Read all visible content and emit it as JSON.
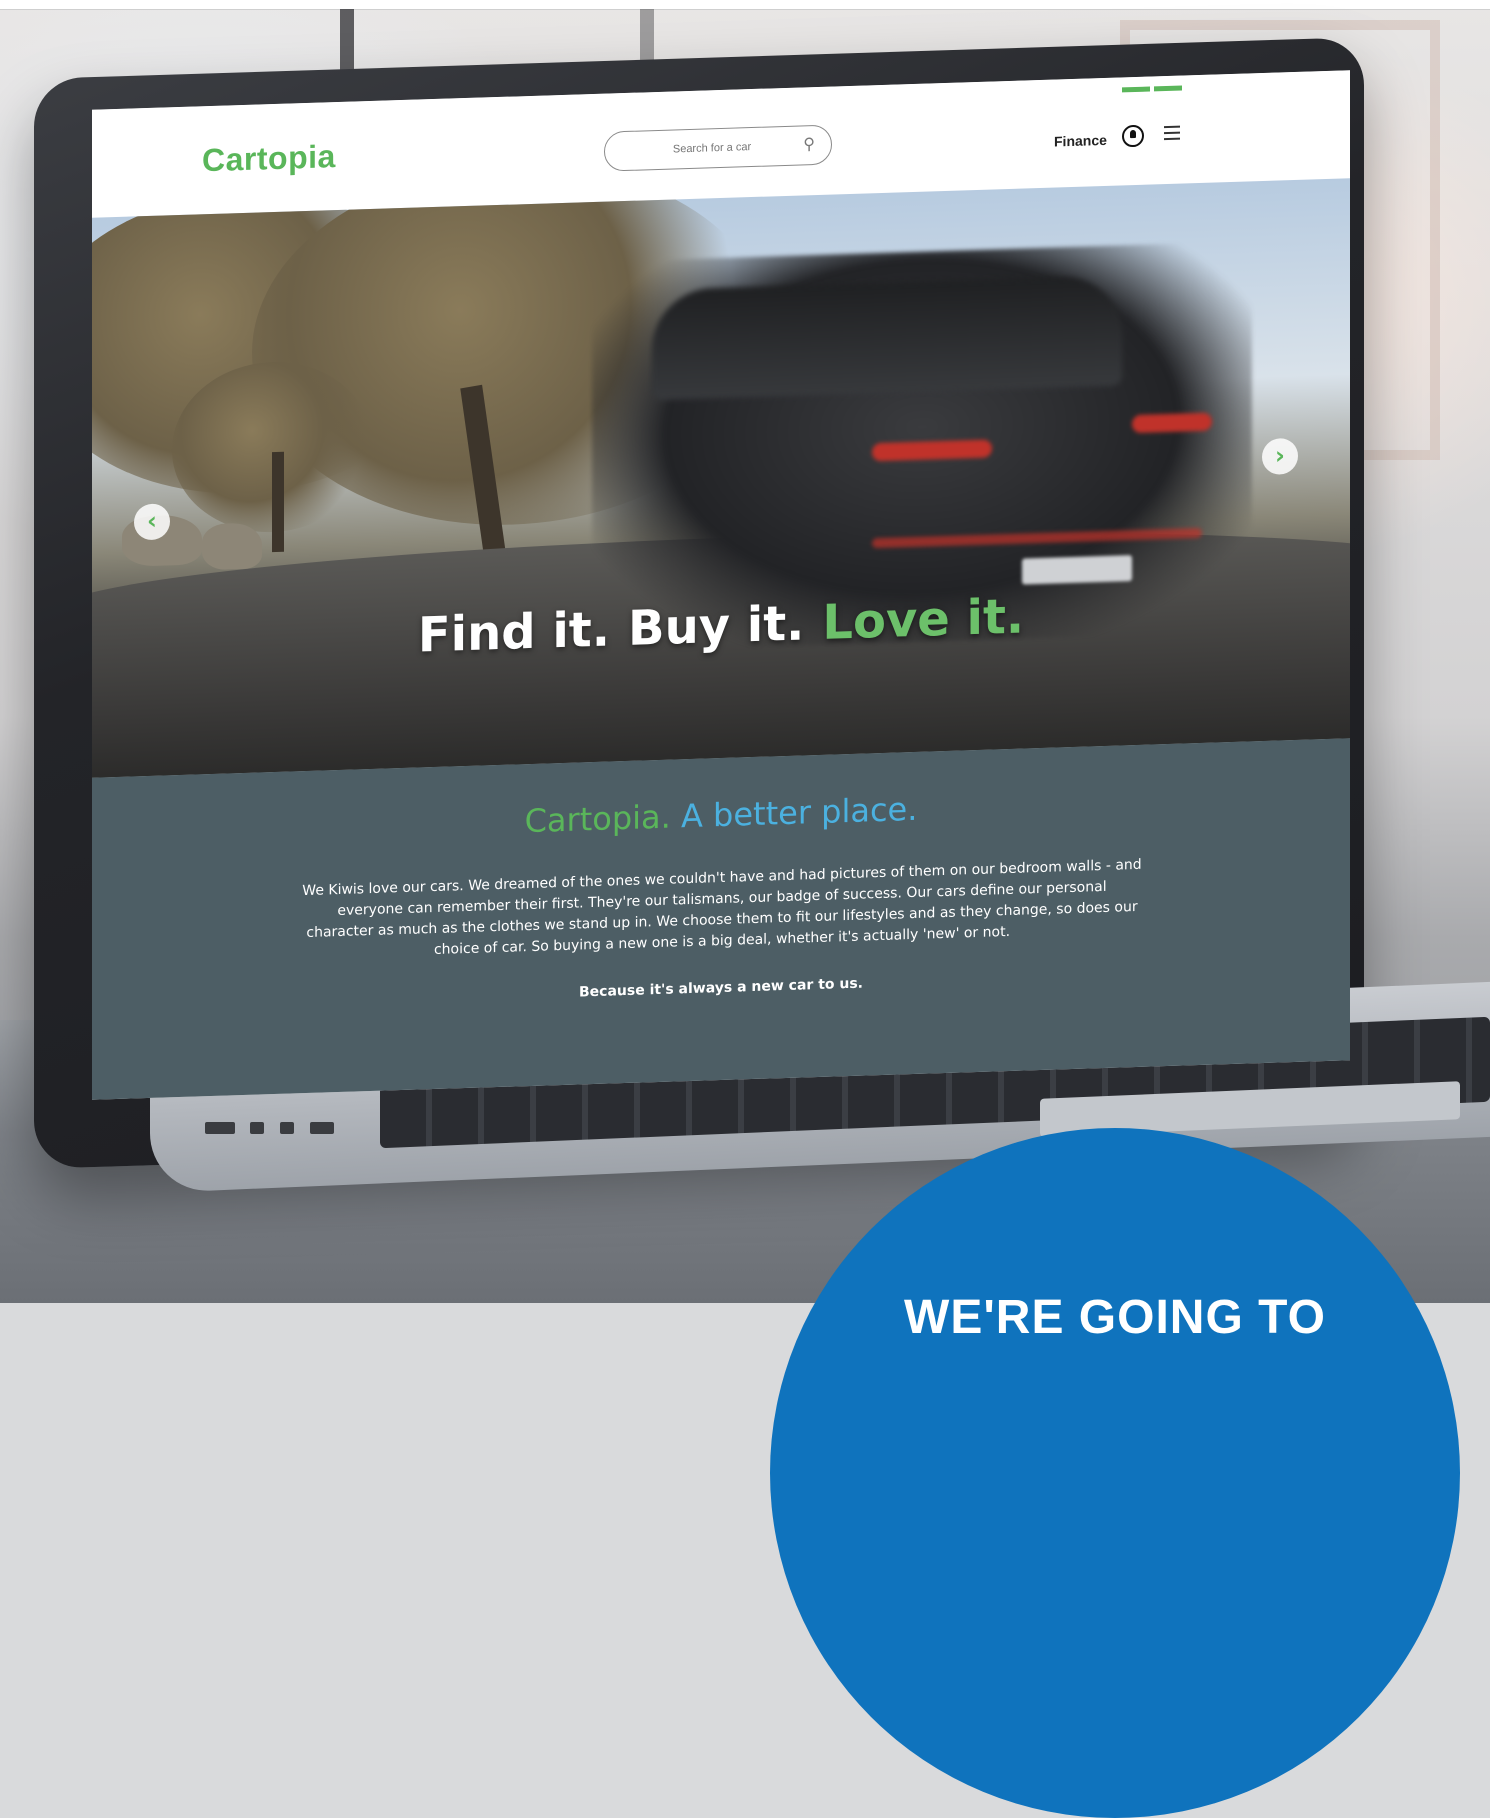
{
  "site": {
    "logo_text": "Cartopia",
    "search_placeholder": "Search for a car",
    "nav_finance": "Finance"
  },
  "hero": {
    "headline_part1": "Find it.",
    "headline_part2": "Buy it.",
    "headline_part3": "Love it."
  },
  "about": {
    "title_part1": "Cartopia.",
    "title_part2": "A better place.",
    "body": "We Kiwis love our cars. We dreamed of the ones we couldn't have and had pictures of them on our bedroom walls - and everyone can remember their first. They're our talismans, our badge of success. Our cars define our personal character as much as the clothes we stand up in.  We choose them to fit our lifestyles and as they change, so does our choice of car. So buying a new one is a big deal, whether it's actually 'new' or not.",
    "tagline": "Because it's always a new car to us."
  },
  "promo": {
    "text": "WE'RE GOING TO"
  },
  "colors": {
    "brand_green": "#5ab65a",
    "accent_blue": "#4bb1e0",
    "section_slate": "#4d5e65",
    "promo_blue": "#0f73bd"
  },
  "icons": {
    "search": "search-icon",
    "user": "user-icon",
    "menu": "menu-icon",
    "prev": "chevron-left-icon",
    "next": "chevron-right-icon"
  }
}
